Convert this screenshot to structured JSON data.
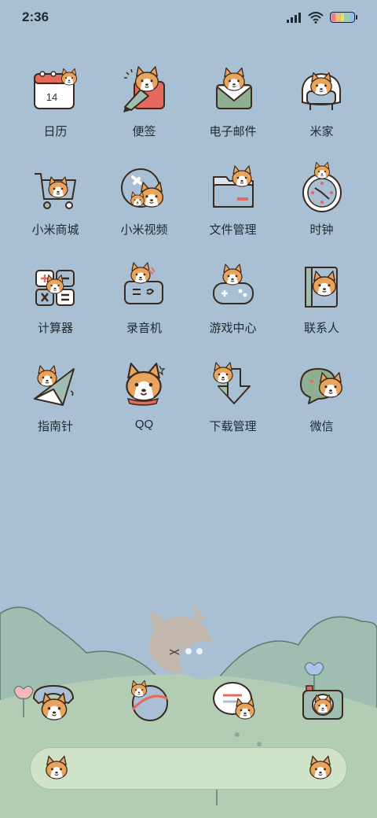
{
  "status_bar": {
    "time": "2:36",
    "battery_colors": [
      "#f07a8e",
      "#f6c36a",
      "#e5e06b",
      "#8fd6a0",
      "#88c0f0"
    ]
  },
  "apps": [
    {
      "label": "日历",
      "icon": "calendar-icon",
      "badge_text": "14"
    },
    {
      "label": "便签",
      "icon": "notes-icon"
    },
    {
      "label": "电子邮件",
      "icon": "email-icon"
    },
    {
      "label": "米家",
      "icon": "mijia-icon"
    },
    {
      "label": "小米商城",
      "icon": "mi-store-icon"
    },
    {
      "label": "小米视频",
      "icon": "mi-video-icon"
    },
    {
      "label": "文件管理",
      "icon": "file-manager-icon"
    },
    {
      "label": "时钟",
      "icon": "clock-icon"
    },
    {
      "label": "计算器",
      "icon": "calculator-icon"
    },
    {
      "label": "录音机",
      "icon": "recorder-icon"
    },
    {
      "label": "游戏中心",
      "icon": "game-center-icon"
    },
    {
      "label": "联系人",
      "icon": "contacts-icon"
    },
    {
      "label": "指南针",
      "icon": "compass-icon"
    },
    {
      "label": "QQ",
      "icon": "qq-icon"
    },
    {
      "label": "下载管理",
      "icon": "download-manager-icon"
    },
    {
      "label": "微信",
      "icon": "wechat-icon"
    }
  ],
  "dock": [
    {
      "icon": "phone-icon"
    },
    {
      "icon": "browser-icon"
    },
    {
      "icon": "messages-icon"
    },
    {
      "icon": "camera-icon"
    }
  ],
  "colors": {
    "background": "#a9c0d4",
    "hill": "#9fbdb0",
    "search_bar": "#cfe3c9",
    "corgi_orange": "#e8a45c"
  }
}
